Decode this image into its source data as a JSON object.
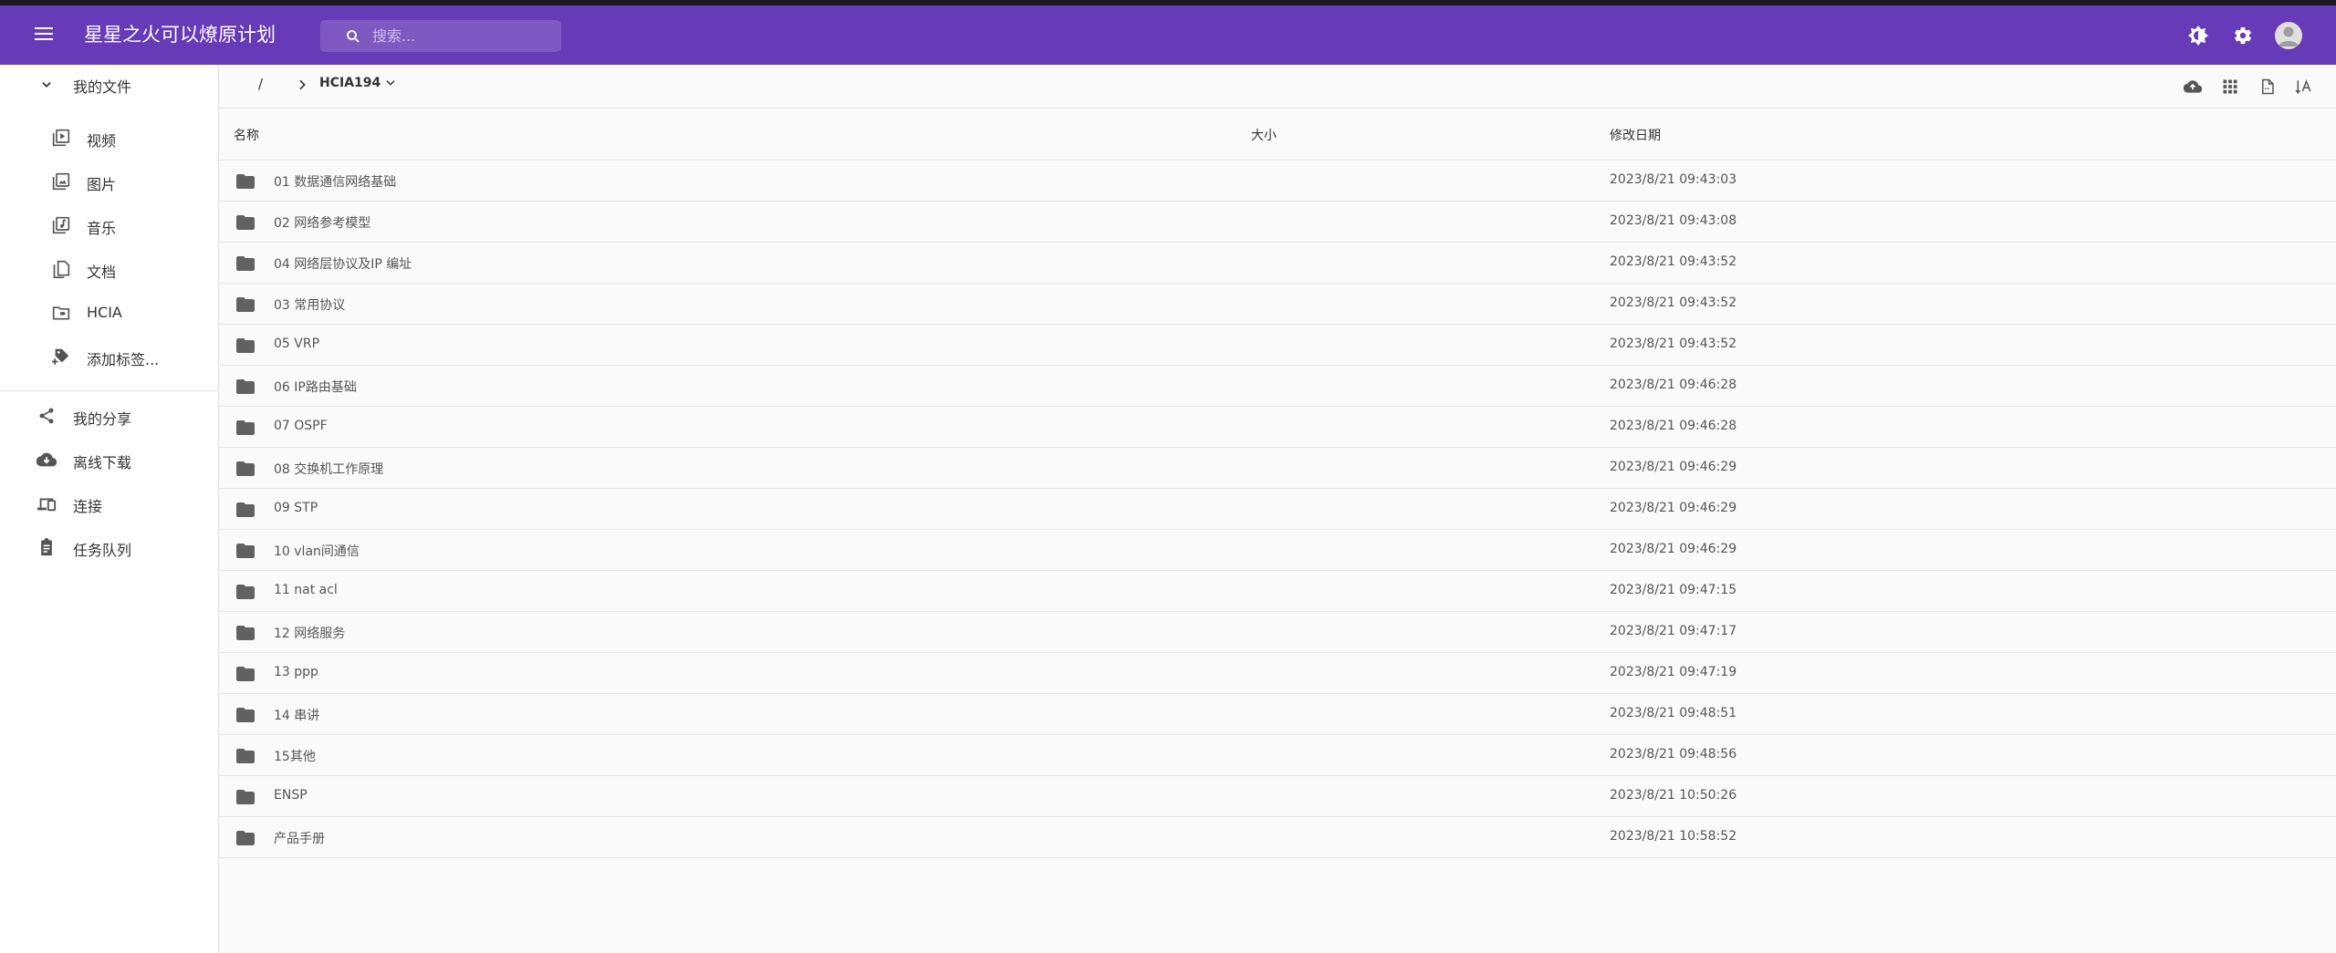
{
  "appbar": {
    "title": "星星之火可以燎原计划",
    "search_placeholder": "搜索..."
  },
  "sidebar": {
    "my_files": "我的文件",
    "sub_items": [
      {
        "label": "视频",
        "icon": "video-icon"
      },
      {
        "label": "图片",
        "icon": "image-icon"
      },
      {
        "label": "音乐",
        "icon": "music-icon"
      },
      {
        "label": "文档",
        "icon": "document-icon"
      },
      {
        "label": "HCIA",
        "icon": "folder-tag-icon"
      },
      {
        "label": "添加标签...",
        "icon": "add-tag-icon"
      }
    ],
    "main_items": [
      {
        "label": "我的分享",
        "icon": "share-icon"
      },
      {
        "label": "离线下载",
        "icon": "cloud-download-icon"
      },
      {
        "label": "连接",
        "icon": "devices-icon"
      },
      {
        "label": "任务队列",
        "icon": "clipboard-icon"
      }
    ]
  },
  "breadcrumb": {
    "root": "/",
    "current": "HCIA194"
  },
  "table": {
    "headers": {
      "name": "名称",
      "size": "大小",
      "modified": "修改日期"
    },
    "rows": [
      {
        "name": "01 数据通信网络基础",
        "size": "",
        "date": "2023/8/21 09:43:03"
      },
      {
        "name": "02 网络参考模型",
        "size": "",
        "date": "2023/8/21 09:43:08"
      },
      {
        "name": "04 网络层协议及IP 编址",
        "size": "",
        "date": "2023/8/21 09:43:52"
      },
      {
        "name": "03 常用协议",
        "size": "",
        "date": "2023/8/21 09:43:52"
      },
      {
        "name": "05 VRP",
        "size": "",
        "date": "2023/8/21 09:43:52"
      },
      {
        "name": "06 IP路由基础",
        "size": "",
        "date": "2023/8/21 09:46:28"
      },
      {
        "name": "07 OSPF",
        "size": "",
        "date": "2023/8/21 09:46:28"
      },
      {
        "name": "08 交换机工作原理",
        "size": "",
        "date": "2023/8/21 09:46:29"
      },
      {
        "name": "09 STP",
        "size": "",
        "date": "2023/8/21 09:46:29"
      },
      {
        "name": "10 vlan间通信",
        "size": "",
        "date": "2023/8/21 09:46:29"
      },
      {
        "name": "11 nat acl",
        "size": "",
        "date": "2023/8/21 09:47:15"
      },
      {
        "name": "12 网络服务",
        "size": "",
        "date": "2023/8/21 09:47:17"
      },
      {
        "name": "13 ppp",
        "size": "",
        "date": "2023/8/21 09:47:19"
      },
      {
        "name": "14 串讲",
        "size": "",
        "date": "2023/8/21 09:48:51"
      },
      {
        "name": "15其他",
        "size": "",
        "date": "2023/8/21 09:48:56"
      },
      {
        "name": "ENSP",
        "size": "",
        "date": "2023/8/21 10:50:26"
      },
      {
        "name": "产品手册",
        "size": "",
        "date": "2023/8/21 10:58:52"
      }
    ]
  },
  "colors": {
    "primary": "#673ab7",
    "background": "#fafafa",
    "folder_icon": "#616161"
  }
}
